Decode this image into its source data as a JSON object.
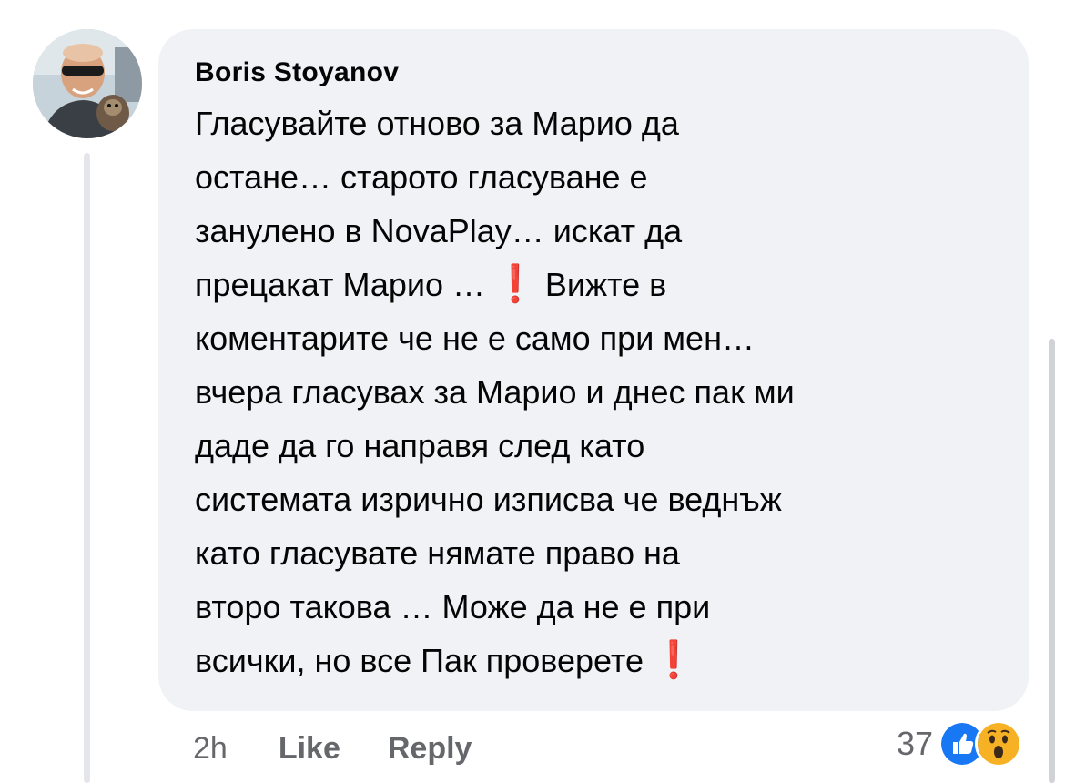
{
  "comment": {
    "author": "Boris Stoyanov",
    "text_lines": [
      "Гласувайте отново за Марио да",
      "остане… старото гласуване е",
      "занулено в NovaPlay… искат да",
      "прецакат Марио …",
      "Вижте в",
      "коментарите че не е само при мен…",
      "вчера гласувах за Марио и днес пак ми",
      "даде да го направя след като",
      "системата изрично изписва че веднъж",
      "като гласувате нямате право на",
      "второ такова … Може да не е при",
      "всички, но все Пак проверете"
    ],
    "timestamp": "2h",
    "like_label": "Like",
    "reply_label": "Reply",
    "reaction_count": "37",
    "reactions": [
      "like-icon",
      "wow-icon"
    ],
    "exclamation_icon": "❗"
  },
  "colors": {
    "bubble": "#f0f2f5",
    "text": "#050505",
    "meta": "#65676b",
    "like_blue": "#1877f2",
    "exclamation": "#e41e3f"
  }
}
